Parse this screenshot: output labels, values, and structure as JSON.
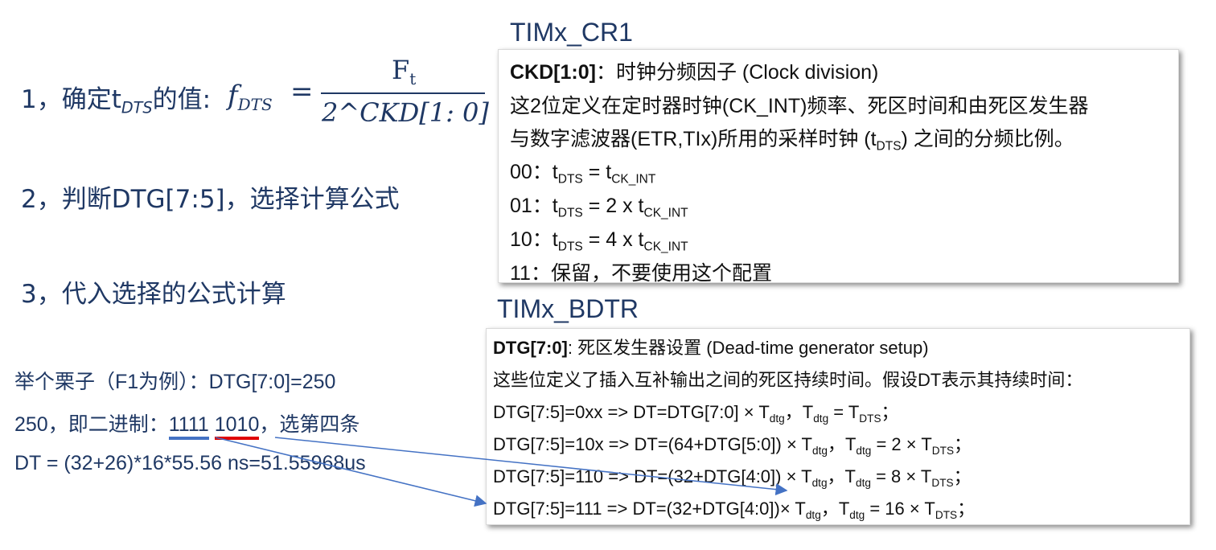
{
  "steps": {
    "s1_prefix": "1，确定t",
    "s1_sub": "DTS",
    "s1_suffix": "的值:",
    "s2": "2，判断DTG[7:5]，选择计算公式",
    "s3": "3，代入选择的公式计算"
  },
  "formula": {
    "lhs": "f",
    "lhs_sub": "DTS",
    "eq": "=",
    "num": "F",
    "num_sub": "t",
    "den": "2^CKD[1: 0]"
  },
  "cr1": {
    "title": "TIMx_CR1",
    "field": "CKD[1:0]",
    "field_desc": "：时钟分频因子 (Clock division)",
    "desc1": "这2位定义在定时器时钟(CK_INT)频率、死区时间和由死区发生器",
    "desc2a": "与数字滤波器(ETR,TIx)所用的采样时钟 (t",
    "desc2_sub": "DTS",
    "desc2b": ") 之间的分频比例。",
    "opt00_code": "00：t",
    "opt00_sub": "DTS",
    "opt00_mid": " = t",
    "opt00_sub2": "CK_INT",
    "opt01_code": "01：t",
    "opt01_sub": "DTS",
    "opt01_mid": " = 2 x t",
    "opt01_sub2": "CK_INT",
    "opt10_code": "10：t",
    "opt10_sub": "DTS",
    "opt10_mid": " = 4 x t",
    "opt10_sub2": "CK_INT",
    "opt11": "11：保留，不要使用这个配置"
  },
  "bdtr": {
    "title": "TIMx_BDTR",
    "field": "DTG[7:0]",
    "field_desc": ": 死区发生器设置 (Dead-time generator setup)",
    "desc": "这些位定义了插入互补输出之间的死区持续时间。假设DT表示其持续时间：",
    "r1a": "DTG[7:5]=0xx => DT=DTG[7:0] × T",
    "r1b": "，T",
    "r1c": " = T",
    "r1d": "；",
    "r2a": "DTG[7:5]=10x => DT=(64+DTG[5:0]) × T",
    "r2b": "，T",
    "r2c": " = 2 × T",
    "r2d": "；",
    "r3a": "DTG[7:5]=110 => DT=(32+DTG[4:0]) × T",
    "r3b": "，T",
    "r3c": " = 8 × T",
    "r3d": "；",
    "r4a": "DTG[7:5]=111 => DT=(32+DTG[4:0])× T",
    "r4b": "，T",
    "r4c": " = 16 × T",
    "r4d": "；",
    "sub_dtg": "dtg",
    "sub_dts": "DTS"
  },
  "example": {
    "line1": "举个栗子（F1为例）：DTG[7:0]=250",
    "line2_pre": "250，即二进制：",
    "bits_high": "1111",
    "bits_low": "1010",
    "line2_post": "，选第四条",
    "line3": "DT = (32+26)*16*55.56 ns=51.55968us"
  },
  "colors": {
    "text_navy": "#1f3864",
    "underline_blue": "#4472c4",
    "underline_red": "#e00000",
    "arrow": "#4472c4"
  }
}
